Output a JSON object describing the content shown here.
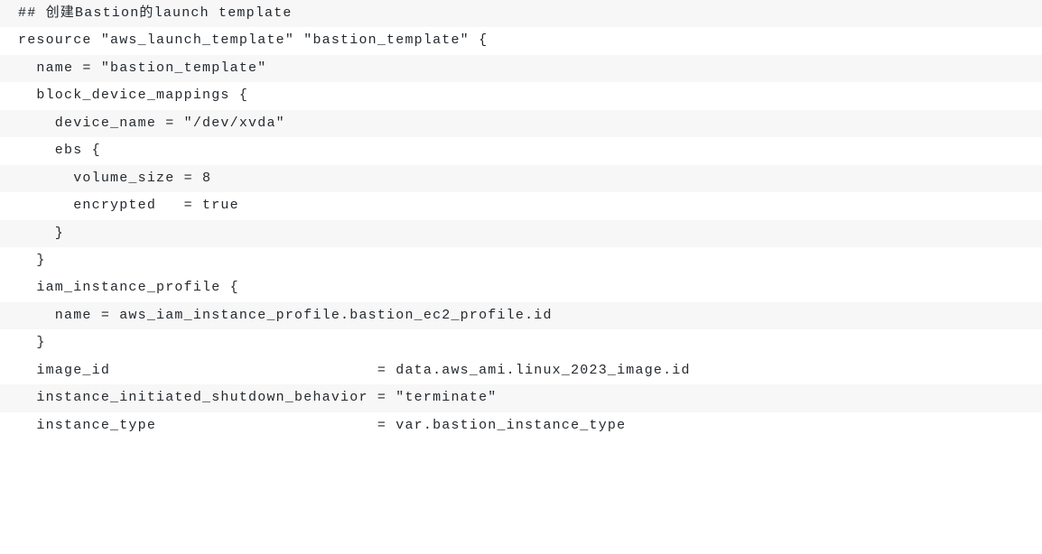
{
  "code": {
    "lines": [
      "## 创建Bastion的launch template",
      "resource \"aws_launch_template\" \"bastion_template\" {",
      "  name = \"bastion_template\"",
      "  block_device_mappings {",
      "    device_name = \"/dev/xvda\"",
      "    ebs {",
      "      volume_size = 8",
      "      encrypted   = true",
      "    }",
      "  }",
      "",
      "  iam_instance_profile {",
      "    name = aws_iam_instance_profile.bastion_ec2_profile.id",
      "  }",
      "",
      "  image_id                             = data.aws_ami.linux_2023_image.id",
      "  instance_initiated_shutdown_behavior = \"terminate\"",
      "  instance_type                        = var.bastion_instance_type"
    ]
  }
}
